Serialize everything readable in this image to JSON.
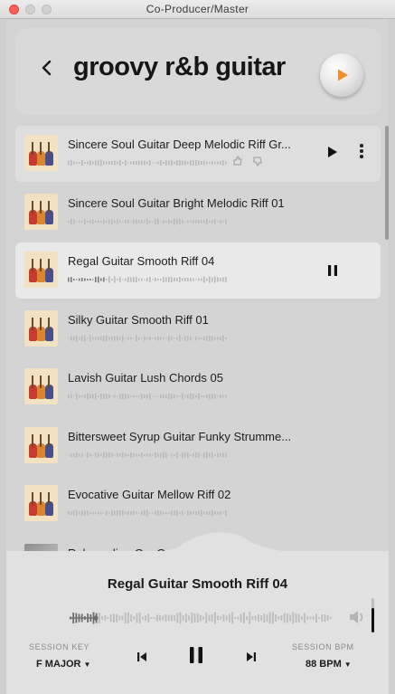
{
  "window": {
    "title": "Co-Producer/Master"
  },
  "header": {
    "back_icon": "chevron-left-icon",
    "search_query": "groovy r&b guitar",
    "play_icon": "play-icon",
    "accent_color": "#f0902c"
  },
  "results": [
    {
      "title": "Sincere Soul Guitar Deep Melodic Riff Gr...",
      "state": "hover",
      "thumbnail": "guitars-artwork"
    },
    {
      "title": "Sincere Soul Guitar Bright Melodic Riff 01",
      "state": "normal",
      "thumbnail": "guitars-artwork"
    },
    {
      "title": "Regal Guitar Smooth Riff 04",
      "state": "playing",
      "thumbnail": "guitars-artwork"
    },
    {
      "title": "Silky Guitar Smooth Riff 01",
      "state": "normal",
      "thumbnail": "guitars-artwork"
    },
    {
      "title": "Lavish Guitar Lush Chords 05",
      "state": "normal",
      "thumbnail": "guitars-artwork"
    },
    {
      "title": "Bittersweet Syrup Guitar Funky Strumme...",
      "state": "normal",
      "thumbnail": "guitars-artwork"
    },
    {
      "title": "Evocative Guitar Mellow Riff 02",
      "state": "normal",
      "thumbnail": "guitars-artwork"
    },
    {
      "title": "Rebounding G...                 Guitar...",
      "state": "partial",
      "thumbnail": "grey-artwork"
    }
  ],
  "player": {
    "now_playing": "Regal Guitar Smooth Riff 04",
    "progress": 0.1,
    "volume": 0.7,
    "session_key_label": "SESSION KEY",
    "session_key_value": "F MAJOR",
    "session_bpm_label": "SESSION BPM",
    "session_bpm_value": "88 BPM"
  }
}
